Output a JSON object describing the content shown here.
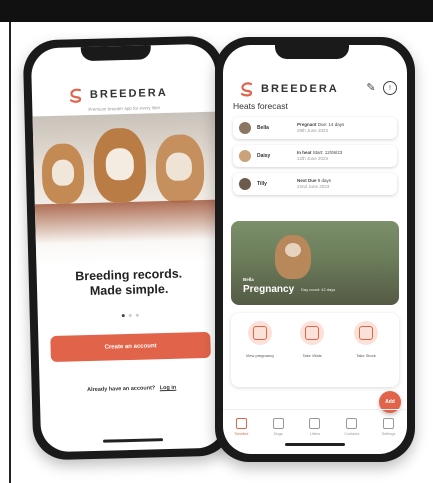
{
  "brand": {
    "name": "BREEDERA",
    "accent": "#e1644a"
  },
  "onboarding": {
    "tagline": "Premium breeder app for every litter",
    "headline_line1": "Breeding records.",
    "headline_line2": "Made simple.",
    "cta_label": "Create an account",
    "login_prompt": "Already have an account?",
    "login_link": "Log in",
    "carousel": {
      "count": 3,
      "active": 1
    }
  },
  "dashboard": {
    "heading": "Heats forecast",
    "heats": [
      {
        "name": "Bella",
        "status": "Pregnant",
        "detail": "Due: 14 days",
        "date": "28th June 2023"
      },
      {
        "name": "Daisy",
        "status": "In heat",
        "detail": "Start: 12/06/23",
        "date": "12th June 2023"
      },
      {
        "name": "Tilly",
        "status": "Next Due",
        "detail": "8 days",
        "date": "22nd June 2023"
      }
    ],
    "pregnancy": {
      "dog": "Bella",
      "title": "Pregnancy",
      "subtitle": "Day count: 42 days"
    },
    "actions": [
      {
        "label": "View pregnancy"
      },
      {
        "label": "Take Vitals"
      },
      {
        "label": "Take Stock"
      }
    ],
    "fab_label": "Add",
    "tabs": [
      {
        "label": "Timeline",
        "active": true
      },
      {
        "label": "Dogs",
        "active": false
      },
      {
        "label": "Litters",
        "active": false
      },
      {
        "label": "Contacts",
        "active": false
      },
      {
        "label": "Settings",
        "active": false
      }
    ]
  }
}
